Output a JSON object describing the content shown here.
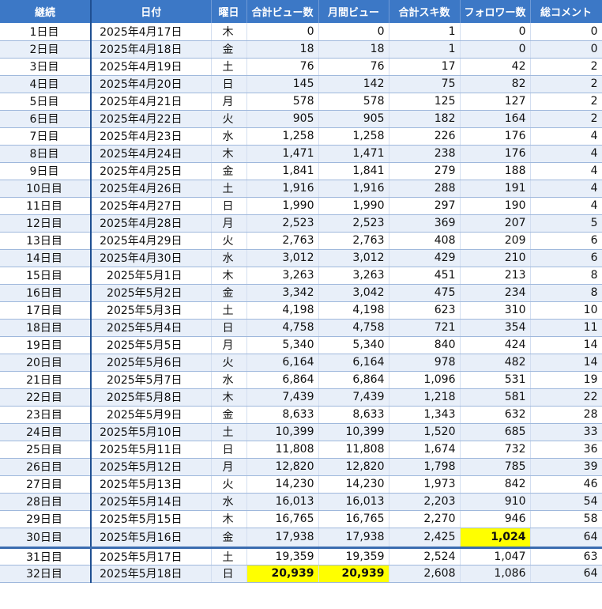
{
  "headers": [
    "継続",
    "日付",
    "曜日",
    "合計ビュー数",
    "月間ビュー",
    "合計スキ数",
    "フォロワー数",
    "総コメント"
  ],
  "rows": [
    [
      "1日目",
      "2025年4月17日",
      "木",
      "0",
      "0",
      "1",
      "0",
      "0"
    ],
    [
      "2日目",
      "2025年4月18日",
      "金",
      "18",
      "18",
      "1",
      "0",
      "0"
    ],
    [
      "3日目",
      "2025年4月19日",
      "土",
      "76",
      "76",
      "17",
      "42",
      "2"
    ],
    [
      "4日目",
      "2025年4月20日",
      "日",
      "145",
      "142",
      "75",
      "82",
      "2"
    ],
    [
      "5日目",
      "2025年4月21日",
      "月",
      "578",
      "578",
      "125",
      "127",
      "2"
    ],
    [
      "6日目",
      "2025年4月22日",
      "火",
      "905",
      "905",
      "182",
      "164",
      "2"
    ],
    [
      "7日目",
      "2025年4月23日",
      "水",
      "1,258",
      "1,258",
      "226",
      "176",
      "4"
    ],
    [
      "8日目",
      "2025年4月24日",
      "木",
      "1,471",
      "1,471",
      "238",
      "176",
      "4"
    ],
    [
      "9日目",
      "2025年4月25日",
      "金",
      "1,841",
      "1,841",
      "279",
      "188",
      "4"
    ],
    [
      "10日目",
      "2025年4月26日",
      "土",
      "1,916",
      "1,916",
      "288",
      "191",
      "4"
    ],
    [
      "11日目",
      "2025年4月27日",
      "日",
      "1,990",
      "1,990",
      "297",
      "190",
      "4"
    ],
    [
      "12日目",
      "2025年4月28日",
      "月",
      "2,523",
      "2,523",
      "369",
      "207",
      "5"
    ],
    [
      "13日目",
      "2025年4月29日",
      "火",
      "2,763",
      "2,763",
      "408",
      "209",
      "6"
    ],
    [
      "14日目",
      "2025年4月30日",
      "水",
      "3,012",
      "3,012",
      "429",
      "210",
      "6"
    ],
    [
      "15日目",
      "2025年5月1日",
      "木",
      "3,263",
      "3,263",
      "451",
      "213",
      "8"
    ],
    [
      "16日目",
      "2025年5月2日",
      "金",
      "3,342",
      "3,042",
      "475",
      "234",
      "8"
    ],
    [
      "17日目",
      "2025年5月3日",
      "土",
      "4,198",
      "4,198",
      "623",
      "310",
      "10"
    ],
    [
      "18日目",
      "2025年5月4日",
      "日",
      "4,758",
      "4,758",
      "721",
      "354",
      "11"
    ],
    [
      "19日目",
      "2025年5月5日",
      "月",
      "5,340",
      "5,340",
      "840",
      "424",
      "14"
    ],
    [
      "20日目",
      "2025年5月6日",
      "火",
      "6,164",
      "6,164",
      "978",
      "482",
      "14"
    ],
    [
      "21日目",
      "2025年5月7日",
      "水",
      "6,864",
      "6,864",
      "1,096",
      "531",
      "19"
    ],
    [
      "22日目",
      "2025年5月8日",
      "木",
      "7,439",
      "7,439",
      "1,218",
      "581",
      "22"
    ],
    [
      "23日目",
      "2025年5月9日",
      "金",
      "8,633",
      "8,633",
      "1,343",
      "632",
      "28"
    ],
    [
      "24日目",
      "2025年5月10日",
      "土",
      "10,399",
      "10,399",
      "1,520",
      "685",
      "33"
    ],
    [
      "25日目",
      "2025年5月11日",
      "日",
      "11,808",
      "11,808",
      "1,674",
      "732",
      "36"
    ],
    [
      "26日目",
      "2025年5月12日",
      "月",
      "12,820",
      "12,820",
      "1,798",
      "785",
      "39"
    ],
    [
      "27日目",
      "2025年5月13日",
      "火",
      "14,230",
      "14,230",
      "1,973",
      "842",
      "46"
    ],
    [
      "28日目",
      "2025年5月14日",
      "水",
      "16,013",
      "16,013",
      "2,203",
      "910",
      "54"
    ],
    [
      "29日目",
      "2025年5月15日",
      "木",
      "16,765",
      "16,765",
      "2,270",
      "946",
      "58"
    ],
    [
      "30日目",
      "2025年5月16日",
      "金",
      "17,938",
      "17,938",
      "2,425",
      "1,024",
      "64"
    ],
    [
      "31日目",
      "2025年5月17日",
      "土",
      "19,359",
      "19,359",
      "2,524",
      "1,047",
      "63"
    ],
    [
      "32日目",
      "2025年5月18日",
      "日",
      "20,939",
      "20,939",
      "2,608",
      "1,086",
      "64"
    ]
  ],
  "highlights": [
    {
      "row": 29,
      "col": 6
    },
    {
      "row": 31,
      "col": 3
    },
    {
      "row": 31,
      "col": 4
    }
  ],
  "colors": {
    "header_bg": "#3c78c6",
    "header_text": "#ffffff",
    "band": "#e8eff9",
    "highlight": "#ffff00"
  }
}
